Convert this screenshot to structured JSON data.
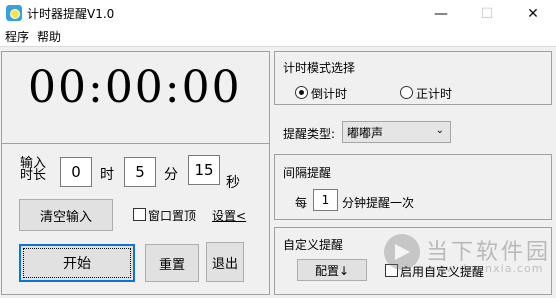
{
  "window": {
    "title": "计时器提醒V1.0"
  },
  "window_controls": {
    "minimize": "—",
    "maximize": "☐",
    "close": "✕"
  },
  "menu": {
    "program": "程序",
    "help": "帮助"
  },
  "timer": {
    "display": "00:00:00"
  },
  "input": {
    "label": "输入\n时长",
    "hours": "0",
    "hours_unit": "时",
    "minutes": "5",
    "minutes_unit": "分",
    "seconds": "15",
    "seconds_unit": "秒"
  },
  "actions": {
    "clear_input": "清空输入",
    "window_top": "窗口置顶",
    "settings": "设置<",
    "start": "开始",
    "reset": "重置",
    "exit": "退出"
  },
  "mode": {
    "title": "计时模式选择",
    "countdown": "倒计时",
    "countup": "正计时",
    "selected": "countdown"
  },
  "reminder": {
    "type_label": "提醒类型:",
    "type_value": "嘟嘟声"
  },
  "interval": {
    "title": "间隔提醒",
    "prefix": "每",
    "value": "1",
    "suffix": "分钟提醒一次"
  },
  "custom": {
    "title": "自定义提醒",
    "config_button": "配置↓",
    "enable_label": "启用自定义提醒"
  },
  "watermark": {
    "name": "当下软件园",
    "url": "www.downxia.com"
  },
  "colors": {
    "focus_blue": "#0078d7",
    "icon_blue": "#3aa0dc",
    "icon_yellow": "#ffe24a"
  }
}
